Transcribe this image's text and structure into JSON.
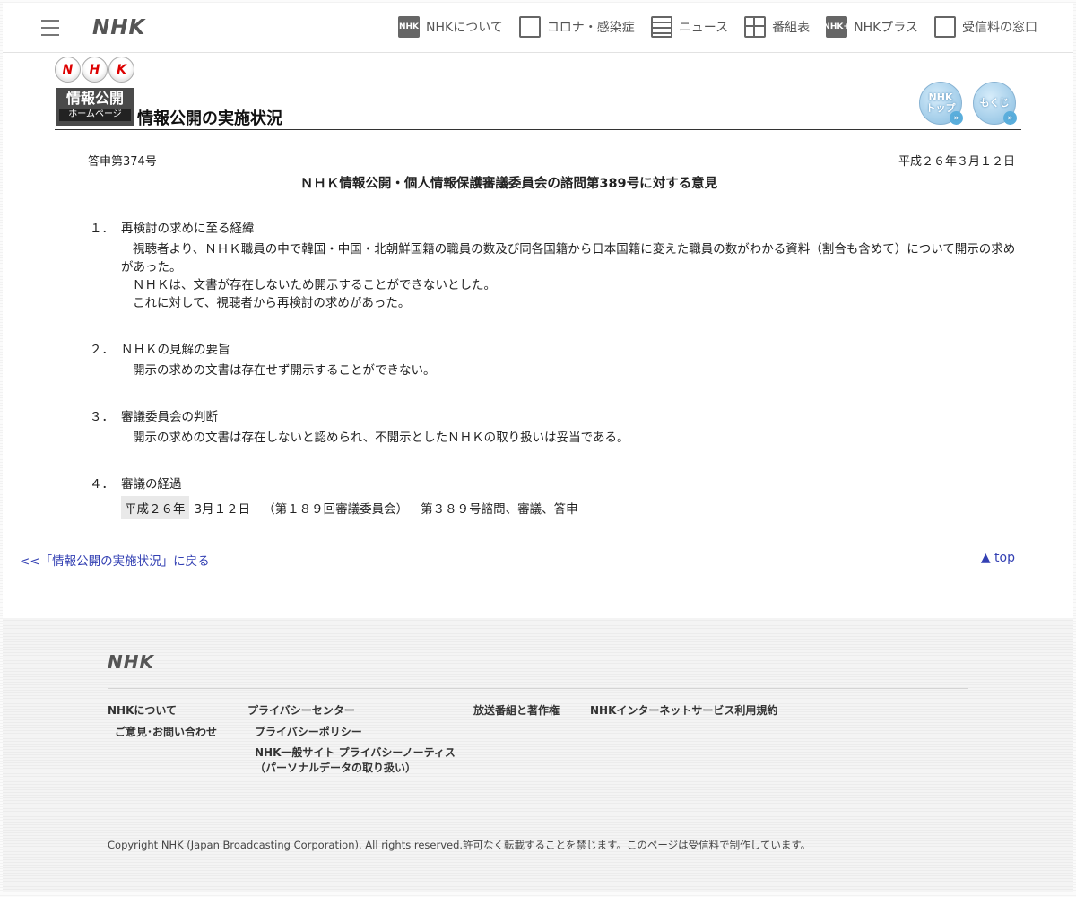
{
  "header": {
    "logo": "NHK",
    "nav": [
      {
        "label": "NHKについて",
        "icon": "nhk-square-icon",
        "icon_text": "NHK"
      },
      {
        "label": "コロナ・感染症",
        "icon": "document-person-icon",
        "icon_text": ""
      },
      {
        "label": "ニュース",
        "icon": "newspaper-icon",
        "icon_text": ""
      },
      {
        "label": "番組表",
        "icon": "grid-icon",
        "icon_text": ""
      },
      {
        "label": "NHKプラス",
        "icon": "nhk-plus-icon",
        "icon_text": "NHK+"
      },
      {
        "label": "受信料の窓口",
        "icon": "tv-icon",
        "icon_text": ""
      }
    ]
  },
  "brand": {
    "balls": [
      "N",
      "H",
      "K"
    ],
    "badge_line1": "情報公開",
    "badge_line2": "ホームページ",
    "heading": "情報公開の実施状況",
    "btn_top": "NHKトップ",
    "btn_top_line1": "NHK",
    "btn_top_line2": "トップ",
    "btn_index": "もくじ",
    "arrow": "»"
  },
  "doc": {
    "number": "答申第374号",
    "date": "平成２６年３月１２日",
    "title": "ＮＨＫ情報公開・個人情報保護審議委員会の諮問第389号に対する意見",
    "sections": [
      {
        "num": "１．",
        "heading": "再検討の求めに至る経緯",
        "paragraphs": [
          "視聴者より、ＮＨＫ職員の中で韓国・中国・北朝鮮国籍の職員の数及び同各国籍から日本国籍に変えた職員の数がわかる資料（割合も含めて）について開示の求めがあった。",
          "ＮＨＫは、文書が存在しないため開示することができないとした。",
          "これに対して、視聴者から再検討の求めがあった。"
        ]
      },
      {
        "num": "２．",
        "heading": "ＮＨＫの見解の要旨",
        "paragraphs": [
          "開示の求めの文書は存在せず開示することができない。"
        ]
      },
      {
        "num": "３．",
        "heading": "審議委員会の判断",
        "paragraphs": [
          "開示の求めの文書は存在しないと認められ、不開示としたＮＨＫの取り扱いは妥当である。"
        ]
      },
      {
        "num": "４．",
        "heading": "審議の経過",
        "schedule": {
          "era": "平成２６年",
          "date": "3月１２日",
          "meeting": "（第１８９回審議委員会）",
          "action": "第３８９号諮問、審議、答申"
        }
      }
    ]
  },
  "links": {
    "back": "<<「情報公開の実施状況」に戻る",
    "top": "▲ top"
  },
  "footer": {
    "logo": "NHK",
    "col1_head": "NHKについて",
    "col1_sub": "ご意見･お問い合わせ",
    "col2_head": "プライバシーセンター",
    "col2_sub1": "プライバシーポリシー",
    "col2_sub2_line1": "NHK一般サイト プライバシーノーティス",
    "col2_sub2_line2": "（パーソナルデータの取り扱い）",
    "col3_head": "放送番組と著作権",
    "col4_head": "NHKインターネットサービス利用規約",
    "copyright": "Copyright NHK (Japan Broadcasting Corporation). All rights reserved.許可なく転載することを禁じます。このページは受信料で制作しています。"
  }
}
